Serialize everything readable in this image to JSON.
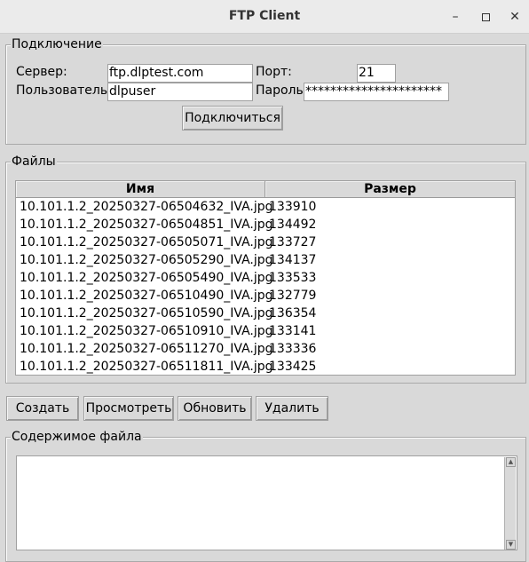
{
  "window": {
    "title": "FTP Client"
  },
  "connection": {
    "legend": "Подключение",
    "server_label": "Сервер:",
    "server_value": "ftp.dlptest.com",
    "port_label": "Порт:",
    "port_value": "21",
    "user_label": "Пользователь:",
    "user_value": "dlpuser",
    "password_label": "Пароль:",
    "password_value": "**********************",
    "connect_label": "Подключиться"
  },
  "files": {
    "legend": "Файлы",
    "columns": [
      "Имя",
      "Размер"
    ],
    "rows": [
      [
        "10.101.1.2_20250327-06504632_IVA.jpg",
        "133910"
      ],
      [
        "10.101.1.2_20250327-06504851_IVA.jpg",
        "134492"
      ],
      [
        "10.101.1.2_20250327-06505071_IVA.jpg",
        "133727"
      ],
      [
        "10.101.1.2_20250327-06505290_IVA.jpg",
        "134137"
      ],
      [
        "10.101.1.2_20250327-06505490_IVA.jpg",
        "133533"
      ],
      [
        "10.101.1.2_20250327-06510490_IVA.jpg",
        "132779"
      ],
      [
        "10.101.1.2_20250327-06510590_IVA.jpg",
        "136354"
      ],
      [
        "10.101.1.2_20250327-06510910_IVA.jpg",
        "133141"
      ],
      [
        "10.101.1.2_20250327-06511270_IVA.jpg",
        "133336"
      ],
      [
        "10.101.1.2_20250327-06511811_IVA.jpg",
        "133425"
      ]
    ]
  },
  "actions": {
    "create_label": "Создать",
    "view_label": "Просмотреть",
    "refresh_label": "Обновить",
    "delete_label": "Удалить"
  },
  "content": {
    "legend": "Содержимое файла",
    "text": ""
  }
}
